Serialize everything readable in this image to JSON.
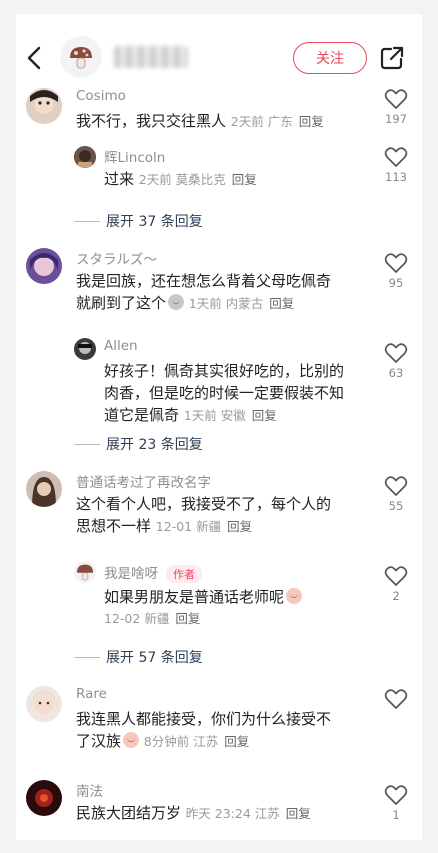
{
  "header": {
    "follow_label": "关注"
  },
  "comments": [
    {
      "user": "Cosimo",
      "text": "我不行，我只交往黑人",
      "time": "2天前",
      "location": "广东",
      "reply_label": "回复",
      "likes": "197",
      "replies": [
        {
          "user": "辉Lincoln",
          "text": "过来",
          "time": "2天前",
          "location": "莫桑比克",
          "reply_label": "回复",
          "likes": "113"
        }
      ],
      "expand_label": "展开 37 条回复"
    },
    {
      "user": "スタラルズ～",
      "text_line1": "我是回族，还在想怎么背着父母吃佩奇",
      "text_line2": "就刷到了这个",
      "time": "1天前",
      "location": "内蒙古",
      "reply_label": "回复",
      "likes": "95",
      "replies": [
        {
          "user": "Allen",
          "text_line1": "好孩子！佩奇其实很好吃的，比别的",
          "text_line2": "肉香，但是吃的时候一定要假装不知",
          "text_line3": "道它是佩奇",
          "time": "1天前",
          "location": "安徽",
          "reply_label": "回复",
          "likes": "63"
        }
      ],
      "expand_label": "展开 23 条回复"
    },
    {
      "user": "普通话考过了再改名字",
      "text_line1": "这个看个人吧，我接受不了，每个人的",
      "text_line2": "思想不一样",
      "time": "12-01",
      "location": "新疆",
      "reply_label": "回复",
      "likes": "55",
      "replies": [
        {
          "user": "我是啥呀",
          "author_tag": "作者",
          "text": "如果男朋友是普通话老师呢",
          "time": "12-02",
          "location": "新疆",
          "reply_label": "回复",
          "likes": "2"
        }
      ],
      "expand_label": "展开 57 条回复"
    },
    {
      "user": "Rare",
      "text_line1": "我连黑人都能接受，你们为什么接受不",
      "text_line2": "了汉族",
      "time": "8分钟前",
      "location": "江苏",
      "reply_label": "回复"
    },
    {
      "user": "南法",
      "text": "民族大团结万岁",
      "time": "昨天 23:24",
      "location": "江苏",
      "reply_label": "回复",
      "likes": "1"
    }
  ],
  "colors": {
    "accent": "#e8495c",
    "link": "#2f3f55",
    "muted": "#8f8f8f"
  },
  "icons": {
    "back": "chevron-left-icon",
    "share": "share-icon",
    "like": "heart-outline-icon"
  }
}
